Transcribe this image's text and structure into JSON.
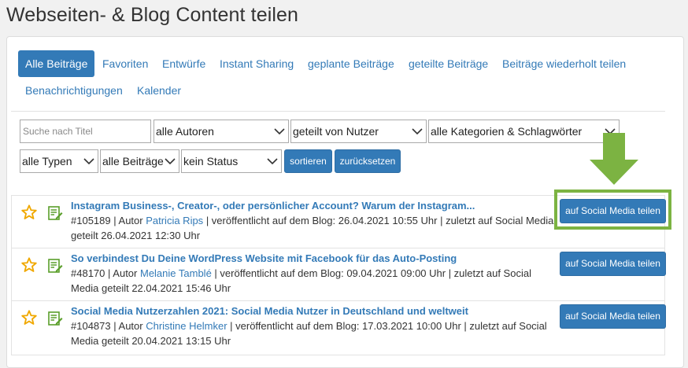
{
  "page": {
    "title": "Webseiten- & Blog Content teilen"
  },
  "tabs": [
    {
      "label": "Alle Beiträge",
      "active": true
    },
    {
      "label": "Favoriten"
    },
    {
      "label": "Entwürfe"
    },
    {
      "label": "Instant Sharing"
    },
    {
      "label": "geplante Beiträge"
    },
    {
      "label": "geteilte Beiträge"
    },
    {
      "label": "Beiträge wiederholt teilen"
    },
    {
      "label": "Benachrichtigungen"
    },
    {
      "label": "Kalender"
    }
  ],
  "filters": {
    "search_placeholder": "Suche nach Titel",
    "author": "alle Autoren",
    "shared_by": "geteilt von Nutzer",
    "categories": "alle Kategorien & Schlagwörter",
    "types": "alle Typen",
    "posts": "alle Beiträge",
    "status": "kein Status",
    "sort_label": "sortieren",
    "reset_label": "zurücksetzen"
  },
  "posts": [
    {
      "title": "Instagram Business-, Creator-, oder persönlicher Account? Warum der Instagram...",
      "id": "#105189",
      "author_prefix": "| Autor",
      "author": "Patricia Rips",
      "meta_rest": "| veröffentlicht auf dem Blog: 26.04.2021 10:55 Uhr | zuletzt auf Social Media",
      "meta_line2": "geteilt 26.04.2021 12:30 Uhr",
      "share_label": "auf Social Media teilen"
    },
    {
      "title": "So verbindest Du Deine WordPress Website mit Facebook für das Auto-Posting",
      "id": "#48170",
      "author_prefix": "| Autor",
      "author": "Melanie Tamblé",
      "meta_rest": "| veröffentlicht auf dem Blog: 09.04.2021 09:00 Uhr | zuletzt auf Social",
      "meta_line2": "Media geteilt 22.04.2021 15:46 Uhr",
      "share_label": "auf Social Media teilen"
    },
    {
      "title": "Social Media Nutzerzahlen 2021: Social Media Nutzer in Deutschland und weltweit",
      "id": "#104873",
      "author_prefix": "| Autor",
      "author": "Christine Helmker",
      "meta_rest": "| veröffentlicht auf dem Blog: 17.03.2021 10:00 Uhr | zuletzt auf Social",
      "meta_line2": "Media geteilt 20.04.2021 13:15 Uhr",
      "share_label": "auf Social Media teilen"
    }
  ],
  "colors": {
    "accent": "#337ab7",
    "star": "#f0a800",
    "doc_icon": "#5a9e2a",
    "highlight": "#7cb342"
  },
  "icons": {
    "favorite": "star-icon",
    "post": "document-edit-icon",
    "pointer": "arrow-down-icon",
    "dropdown": "chevron-down-icon"
  }
}
